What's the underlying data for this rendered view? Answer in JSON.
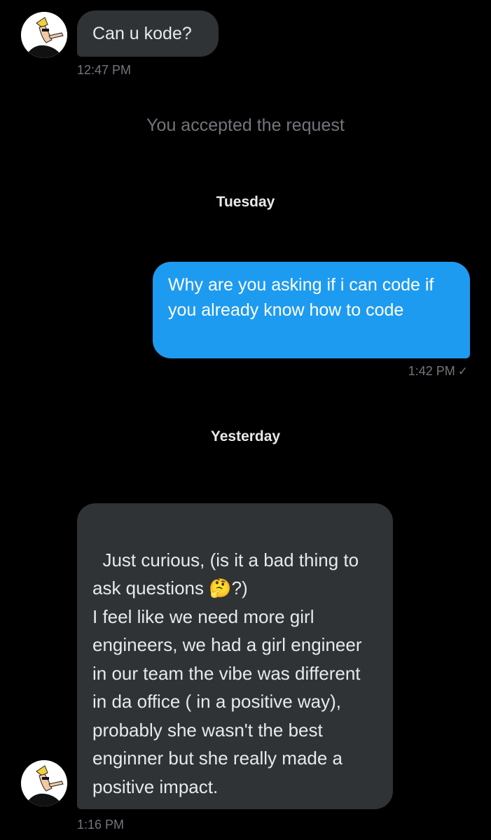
{
  "conversation": {
    "msg1": {
      "text": "Can u kode?",
      "time": "12:47 PM",
      "avatar_icon": "cartoon-avatar-icon"
    },
    "system_notice": "You accepted the request",
    "day1": "Tuesday",
    "msg2": {
      "text": "Why are you asking if i can code if you already know how to code",
      "time": "1:42 PM",
      "status_icon": "✓"
    },
    "day2": "Yesterday",
    "msg3": {
      "text": "Just curious, (is it a bad thing to ask questions 🤔?)\nI feel like we need more girl engineers, we had a girl engineer in our team the vibe was different in da office ( in a positive way), probably she wasn't the best enginner but she really made a positive impact.",
      "time": "1:16 PM",
      "avatar_icon": "cartoon-avatar-icon"
    }
  },
  "colors": {
    "background": "#000000",
    "incoming_bubble": "#2f3336",
    "outgoing_bubble": "#1d9bf0",
    "muted_text": "#71767b"
  }
}
